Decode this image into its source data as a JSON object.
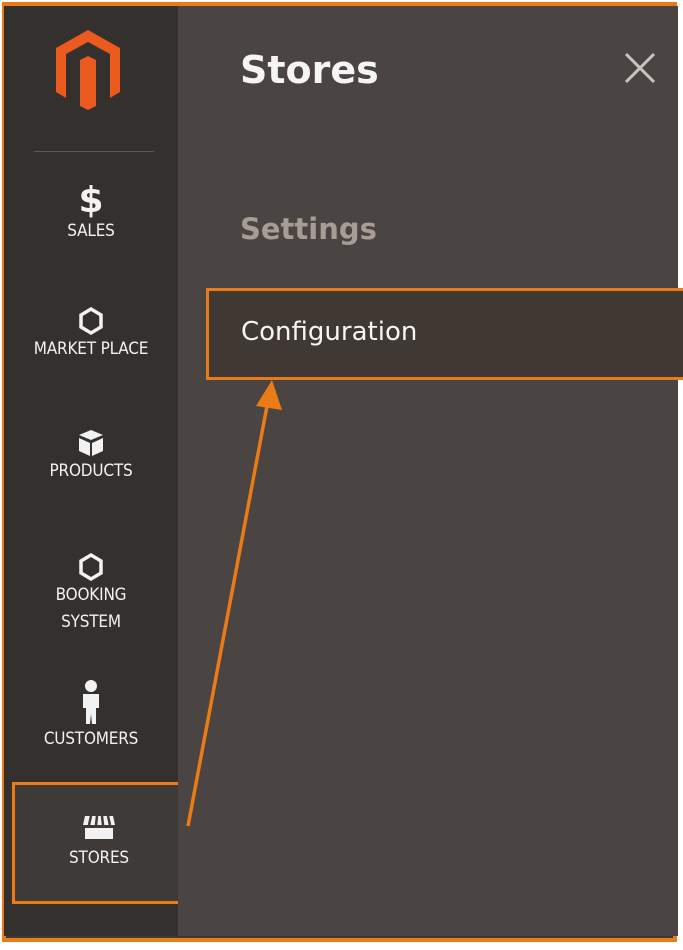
{
  "nav": {
    "items": [
      {
        "label": "SALES",
        "icon": "dollar-icon"
      },
      {
        "label": "MARKET PLACE",
        "icon": "hexagon-icon"
      },
      {
        "label": "PRODUCTS",
        "icon": "box-icon"
      },
      {
        "label": "BOOKING SYSTEM",
        "icon": "hexagon-icon"
      },
      {
        "label": "CUSTOMERS",
        "icon": "person-icon"
      },
      {
        "label": "STORES",
        "icon": "storefront-icon"
      }
    ]
  },
  "panel": {
    "title": "Stores",
    "section": "Settings",
    "link": "Configuration"
  },
  "colors": {
    "accent": "#eb7b17",
    "sidebar": "#33302e",
    "panel": "#4a4542"
  }
}
